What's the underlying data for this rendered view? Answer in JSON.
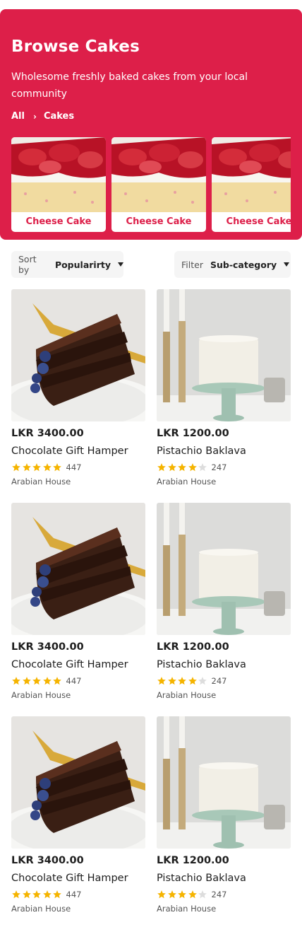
{
  "header": {
    "title": "Browse Cakes",
    "subtitle": "Wholesome freshly baked cakes from your local community",
    "breadcrumb": {
      "root": "All",
      "current": "Cakes"
    }
  },
  "categories": [
    {
      "label": "Cheese Cake"
    },
    {
      "label": "Cheese Cake"
    },
    {
      "label": "Cheese Cake"
    }
  ],
  "toolbar": {
    "sort": {
      "label": "Sort by",
      "value": "Popularirty"
    },
    "filter": {
      "label": "Filter",
      "value": "Sub-category"
    }
  },
  "colors": {
    "accent": "#dd1f49",
    "star": "#f5b400",
    "star_empty": "#dddddd"
  },
  "products": [
    {
      "price": "LKR 3400.00",
      "name": "Chocolate Gift Hamper",
      "rating": 5,
      "reviews": "447",
      "vendor": "Arabian House",
      "image": "chocolate-cake"
    },
    {
      "price": "LKR 1200.00",
      "name": "Pistachio Baklava",
      "rating": 4,
      "reviews": "247",
      "vendor": "Arabian House",
      "image": "white-cake"
    },
    {
      "price": "LKR 3400.00",
      "name": "Chocolate Gift Hamper",
      "rating": 5,
      "reviews": "447",
      "vendor": "Arabian House",
      "image": "chocolate-cake"
    },
    {
      "price": "LKR 1200.00",
      "name": "Pistachio Baklava",
      "rating": 4,
      "reviews": "247",
      "vendor": "Arabian House",
      "image": "white-cake"
    },
    {
      "price": "LKR 3400.00",
      "name": "Chocolate Gift Hamper",
      "rating": 5,
      "reviews": "447",
      "vendor": "Arabian House",
      "image": "chocolate-cake"
    },
    {
      "price": "LKR 1200.00",
      "name": "Pistachio Baklava",
      "rating": 4,
      "reviews": "247",
      "vendor": "Arabian House",
      "image": "white-cake"
    }
  ]
}
